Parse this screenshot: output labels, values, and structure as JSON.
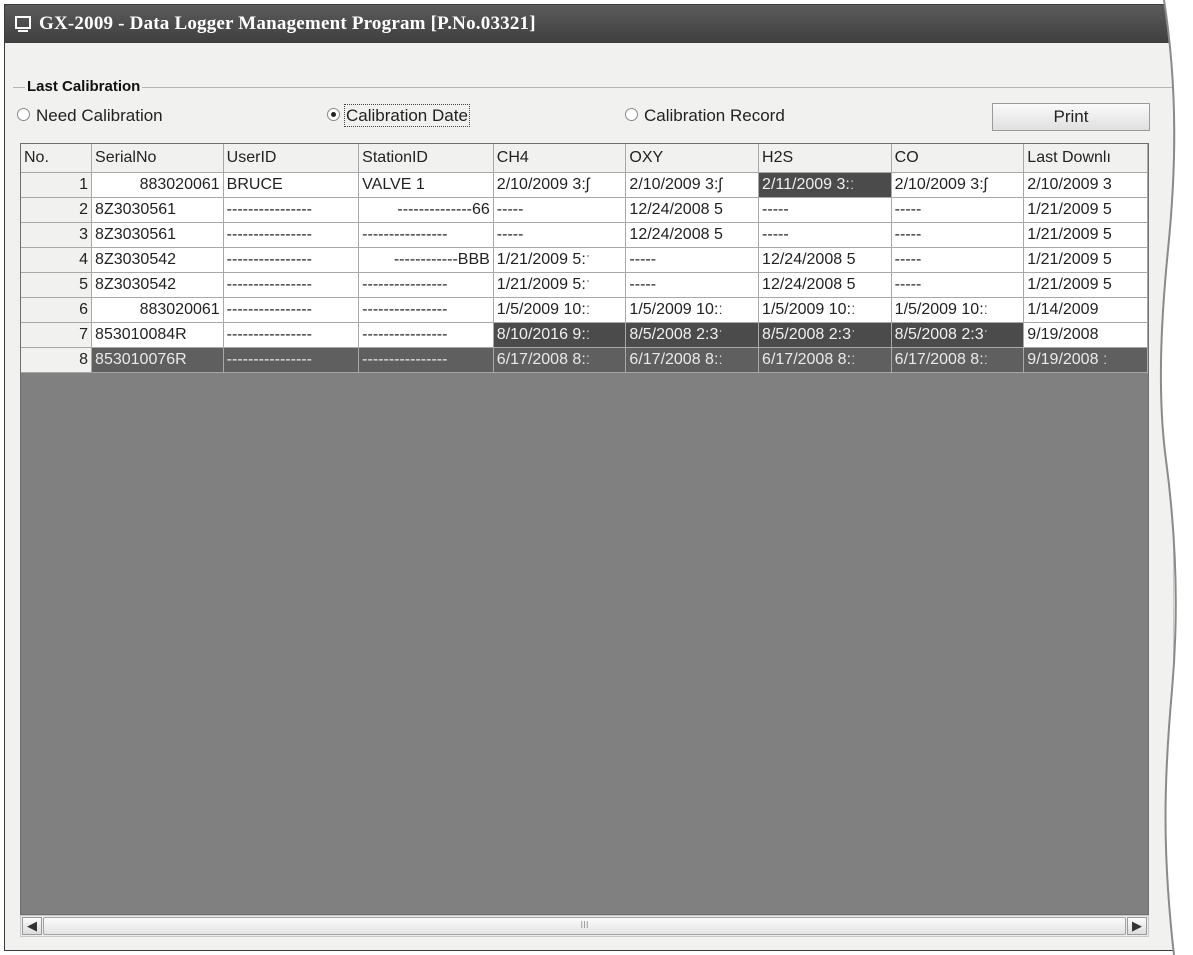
{
  "window": {
    "title": "GX-2009  - Data Logger Management Program [P.No.03321]"
  },
  "group": {
    "title": "Last Calibration"
  },
  "radios": [
    {
      "label": "Need Calibration",
      "selected": false
    },
    {
      "label": "Calibration Date",
      "selected": true
    },
    {
      "label": "Calibration Record",
      "selected": false
    }
  ],
  "print_button": {
    "label": "Print"
  },
  "table": {
    "columns": [
      "No.",
      "SerialNo",
      "UserID",
      "StationID",
      "CH4",
      "OXY",
      "H2S",
      "CO",
      "Last Downlı"
    ],
    "rows": [
      {
        "no": "1",
        "serial": "883020061",
        "user": "BRUCE",
        "station": "VALVE 1",
        "ch4": "2/10/2009 3:ʃ",
        "oxy": "2/10/2009 3:ʃ",
        "h2s": "2/11/2009 3:ː",
        "co": "2/10/2009 3:ʃ",
        "last": "2/10/2009 3"
      },
      {
        "no": "2",
        "serial": "8Z3030561",
        "user": "----------------",
        "station": "--------------66",
        "ch4": "-----",
        "oxy": "12/24/2008 5",
        "h2s": "-----",
        "co": "-----",
        "last": "1/21/2009 5"
      },
      {
        "no": "3",
        "serial": "8Z3030561",
        "user": "----------------",
        "station": "----------------",
        "ch4": "-----",
        "oxy": "12/24/2008 5",
        "h2s": "-----",
        "co": "-----",
        "last": "1/21/2009 5"
      },
      {
        "no": "4",
        "serial": "8Z3030542",
        "user": "----------------",
        "station": "------------BBB",
        "ch4": "1/21/2009 5:ˑ",
        "oxy": "-----",
        "h2s": "12/24/2008 5",
        "co": "-----",
        "last": "1/21/2009 5"
      },
      {
        "no": "5",
        "serial": "8Z3030542",
        "user": "----------------",
        "station": "----------------",
        "ch4": "1/21/2009 5:ˑ",
        "oxy": "-----",
        "h2s": "12/24/2008 5",
        "co": "-----",
        "last": "1/21/2009 5"
      },
      {
        "no": "6",
        "serial": "883020061",
        "user": "----------------",
        "station": "----------------",
        "ch4": "1/5/2009 10:ː",
        "oxy": "1/5/2009 10:ː",
        "h2s": "1/5/2009 10:ː",
        "co": "1/5/2009 10:ː",
        "last": "1/14/2009"
      },
      {
        "no": "7",
        "serial": "853010084R",
        "user": "----------------",
        "station": "----------------",
        "ch4": "8/10/2016 9:ː",
        "oxy": "8/5/2008 2:3ˑ",
        "h2s": "8/5/2008 2:3ˑ",
        "co": "8/5/2008 2:3ˑ",
        "last": "9/19/2008"
      },
      {
        "no": "8",
        "serial": "853010076R",
        "user": "----------------",
        "station": "----------------",
        "ch4": "6/17/2008 8:ː",
        "oxy": "6/17/2008 8:ː",
        "h2s": "6/17/2008 8:ː",
        "co": "6/17/2008 8:ː",
        "last": "9/19/2008 ː"
      }
    ]
  },
  "scrollbar": {
    "grip": "III"
  }
}
